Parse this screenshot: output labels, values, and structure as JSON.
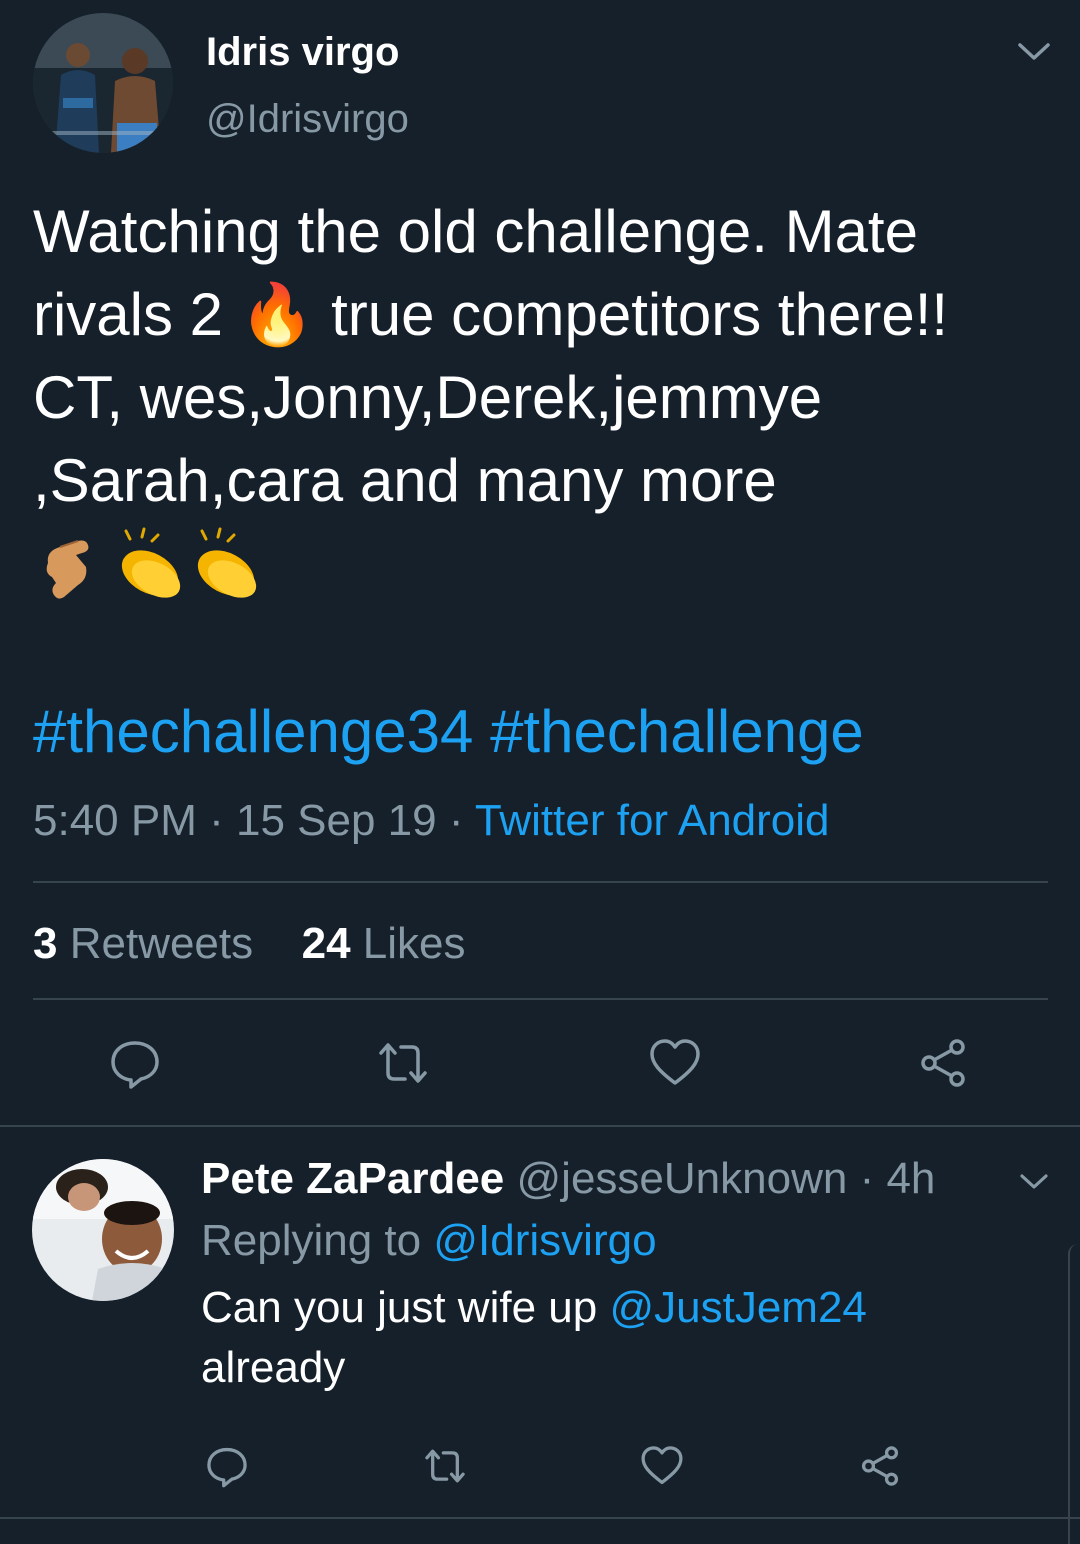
{
  "tweet": {
    "display_name": "Idris virgo",
    "handle": "@Idrisvirgo",
    "text_lines": [
      "Watching the old challenge. Mate",
      "rivals 2 🔥 true competitors there!!",
      "CT, wes,Jonny,Derek,jemmye",
      ",Sarah,cara and many more"
    ],
    "hashtags": [
      "#thechallenge34",
      "#thechallenge"
    ],
    "time": "5:40 PM",
    "date": "15 Sep 19",
    "source": "Twitter for Android",
    "separator": " · ",
    "retweets_count": "3",
    "retweets_label": "Retweets",
    "likes_count": "24",
    "likes_label": "Likes"
  },
  "reply": {
    "display_name": "Pete ZaPardee",
    "handle": "@jesseUnknown",
    "age": "4h",
    "replying_prefix": "Replying to",
    "replying_to": "@Idrisvirgo",
    "text_before": "Can you just wife up",
    "mention": "@JustJem24",
    "text_after": "already"
  },
  "icons": {
    "reply": "reply-bubble-icon",
    "retweet": "retweet-icon",
    "like": "heart-icon",
    "share": "share-icon",
    "menu": "chevron-down-icon"
  },
  "colors": {
    "background": "#15202b",
    "accent": "#1da1f2",
    "muted": "#8899a6",
    "divider": "#38444d"
  }
}
